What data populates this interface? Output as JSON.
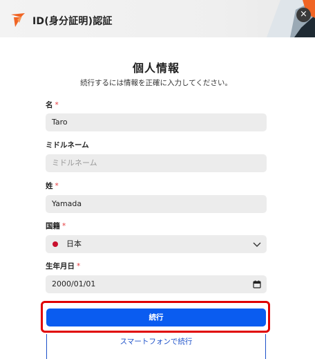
{
  "header": {
    "title": "ID(身分証明)認証",
    "close_label": "×",
    "logo_icon": "orange-arrow-logo-icon",
    "accent_color": "#f06423"
  },
  "form": {
    "title": "個人情報",
    "subtitle": "続行するには情報を正確に入力してください。",
    "required_mark": "*",
    "fields": [
      {
        "label": "名",
        "value": "Taro",
        "required": true
      },
      {
        "label": "ミドルネーム",
        "placeholder": "ミドルネーム",
        "value": "",
        "required": false
      },
      {
        "label": "姓",
        "value": "Yamada",
        "required": true
      },
      {
        "label": "国籍",
        "value": "日本",
        "required": true,
        "icon": "japan-flag-icon"
      },
      {
        "label": "生年月日",
        "value": "2000/01/01",
        "required": true,
        "icon": "calendar-icon"
      }
    ]
  },
  "buttons": {
    "continue_label": "続行",
    "continue_color": "#0a5cf0",
    "phone_label": "スマートフォンで続行",
    "highlight_color": "#e00000"
  }
}
